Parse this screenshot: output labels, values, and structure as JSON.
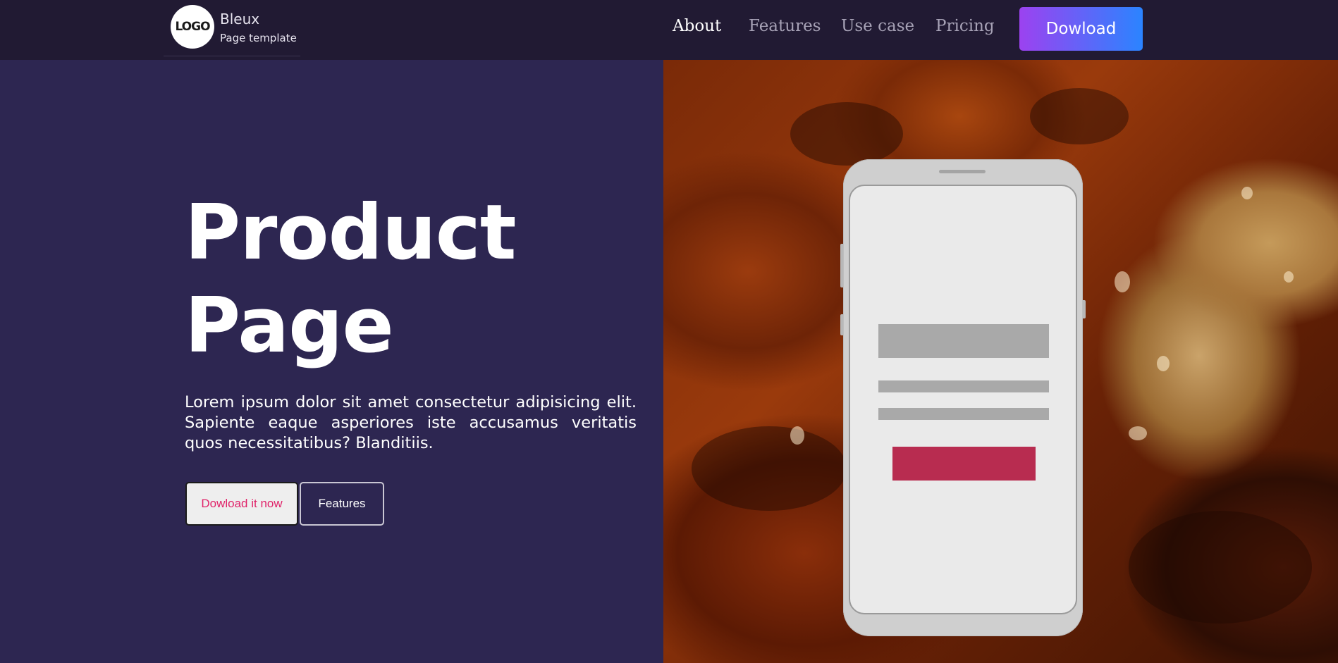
{
  "header": {
    "logo_text": "LOGO",
    "brand_name": "Bleux",
    "brand_subtitle": "Page template",
    "nav": [
      {
        "label": "About",
        "active": true
      },
      {
        "label": "Features",
        "active": false
      },
      {
        "label": "Use case",
        "active": false
      },
      {
        "label": "Pricing",
        "active": false
      }
    ],
    "download_label": "Dowload"
  },
  "hero": {
    "title_line1": "Product",
    "title_line2": "Page",
    "description": "Lorem ipsum dolor sit amet consectetur adipisicing elit. Sapiente eaque asperiores iste accusamus veritatis quos necessitatibus? Blanditiis.",
    "primary_button": "Dowload it now",
    "secondary_button": "Features"
  },
  "colors": {
    "header_bg": "#211a33",
    "hero_bg": "#2d2651",
    "accent_gradient_start": "#9c42f0",
    "accent_gradient_end": "#2b84ff",
    "primary_button_text": "#e0246a",
    "phone_button": "#b82c50"
  },
  "icons": {
    "logo": "logo-circle-icon"
  }
}
